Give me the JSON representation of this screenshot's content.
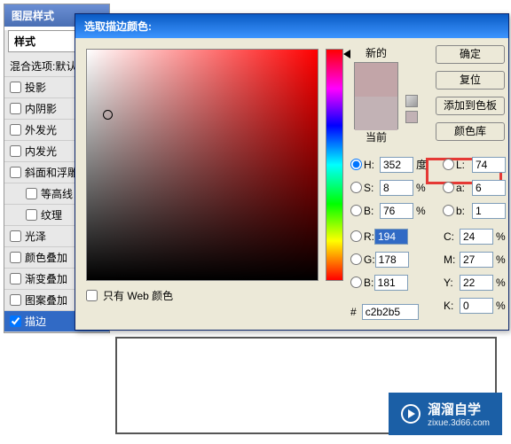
{
  "panel": {
    "title": "图层样式",
    "header": "样式",
    "items": [
      {
        "label": "混合选项:默认",
        "checked": false,
        "indent": false
      },
      {
        "label": "投影",
        "checked": false,
        "indent": false
      },
      {
        "label": "内阴影",
        "checked": false,
        "indent": false
      },
      {
        "label": "外发光",
        "checked": false,
        "indent": false
      },
      {
        "label": "内发光",
        "checked": false,
        "indent": false
      },
      {
        "label": "斜面和浮雕",
        "checked": false,
        "indent": false
      },
      {
        "label": "等高线",
        "checked": false,
        "indent": true
      },
      {
        "label": "纹理",
        "checked": false,
        "indent": true
      },
      {
        "label": "光泽",
        "checked": false,
        "indent": false
      },
      {
        "label": "颜色叠加",
        "checked": false,
        "indent": false
      },
      {
        "label": "渐变叠加",
        "checked": false,
        "indent": false
      },
      {
        "label": "图案叠加",
        "checked": false,
        "indent": false
      },
      {
        "label": "描边",
        "checked": true,
        "indent": false
      }
    ]
  },
  "dialog": {
    "title": "选取描边颜色:",
    "new_label": "新的",
    "cur_label": "当前",
    "buttons": {
      "ok": "确定",
      "reset": "复位",
      "add": "添加到色板",
      "lib": "颜色库"
    },
    "webonly": "只有 Web 颜色",
    "hsb": {
      "h": "H:",
      "hv": "352",
      "hu": "度",
      "s": "S:",
      "sv": "8",
      "su": "%",
      "b": "B:",
      "bv": "76",
      "bu": "%"
    },
    "rgb": {
      "r": "R:",
      "rv": "194",
      "g": "G:",
      "gv": "178",
      "b": "B:",
      "bv": "181"
    },
    "lab": {
      "l": "L:",
      "lv": "74",
      "a": "a:",
      "av": "6",
      "b": "b:",
      "bv": "1"
    },
    "cmyk": {
      "c": "C:",
      "cv": "24",
      "cu": "%",
      "m": "M:",
      "mv": "27",
      "mu": "%",
      "y": "Y:",
      "yv": "22",
      "yu": "%",
      "k": "K:",
      "kv": "0",
      "ku": "%"
    },
    "hex_label": "#",
    "hex": "c2b2b5"
  },
  "watermark": {
    "brand": "溜溜自学",
    "url": "zixue.3d66.com"
  }
}
